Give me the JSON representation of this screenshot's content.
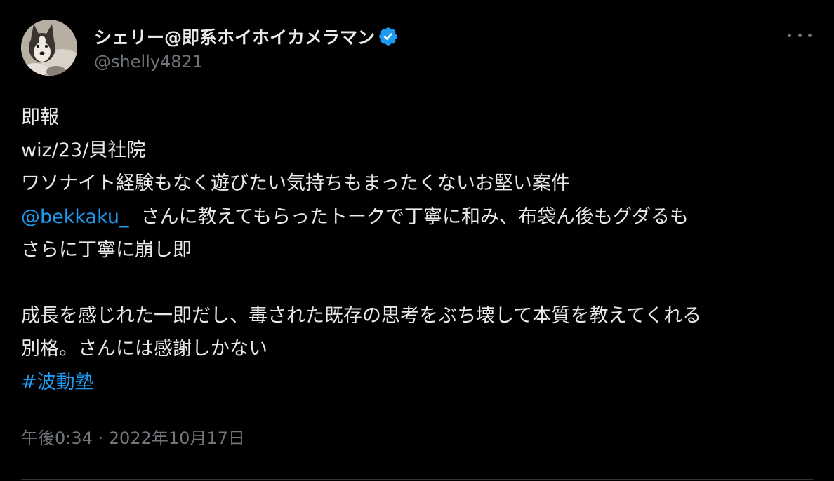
{
  "author": {
    "display_name": "シェリー@即系ホイホイカメラマン",
    "handle": "@shelly4821",
    "verified": true,
    "avatar_icon": "husky-dog-avatar"
  },
  "menu": {
    "more_icon": "more-horizontal-icon"
  },
  "tweet": {
    "line1": "即報",
    "line2": "wiz/23/貝社院",
    "line3": "ワソナイト経験もなく遊びたい気持ちもまったくないお堅い案件",
    "mention": "@bekkaku_",
    "line4_rest": "さんに教えてもらったトークで丁寧に和み、布袋ん後もグダるも",
    "line5": "さらに丁寧に崩し即",
    "line6": "成長を感じれた一即だし、毒された既存の思考をぶち壊して本質を教えてくれる",
    "line7": "別格。さんには感謝しかない",
    "hashtag": "#波動塾"
  },
  "meta": {
    "timestamp": "午後0:34 · 2022年10月17日"
  },
  "colors": {
    "background": "#000000",
    "text": "#e7e9ea",
    "secondary": "#71767b",
    "link": "#1d9bf0",
    "verified": "#1d9bf0"
  }
}
